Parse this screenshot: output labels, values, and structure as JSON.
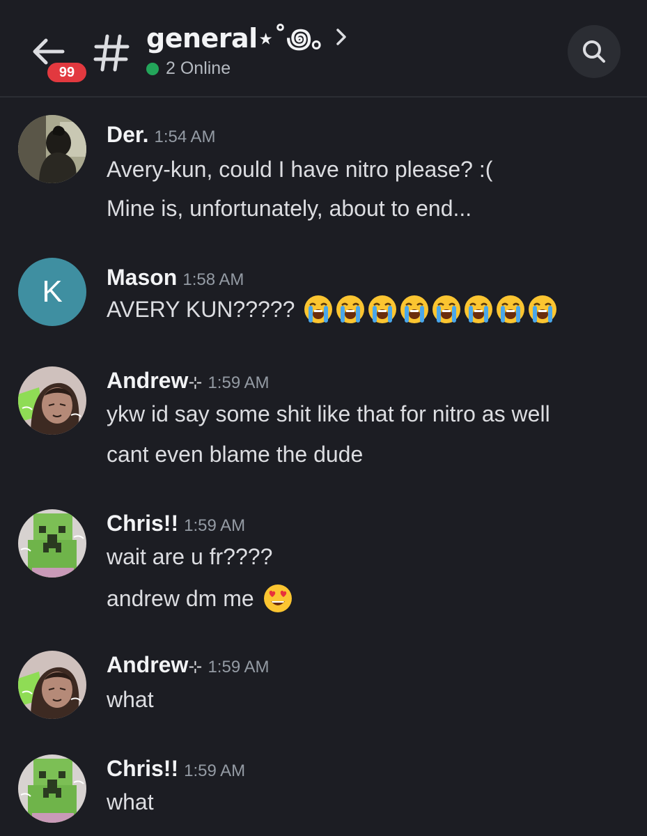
{
  "header": {
    "badge_count": "99",
    "channel_name": "general⋆˚꩜｡",
    "online_text": "2 Online"
  },
  "messages": [
    {
      "author": "Der.",
      "time": "1:54 AM",
      "lines": [
        "Avery-kun, could I have nitro please? :(",
        "Mine is, unfortunately, about to end..."
      ]
    },
    {
      "author": "Mason",
      "avatar_letter": "K",
      "time": "1:58 AM",
      "lines": [
        "AVERY KUN?????"
      ],
      "emoji": [
        "loudly-crying-face",
        "loudly-crying-face",
        "loudly-crying-face",
        "loudly-crying-face",
        "loudly-crying-face",
        "loudly-crying-face",
        "loudly-crying-face",
        "loudly-crying-face"
      ]
    },
    {
      "author": "Andrew",
      "author_suffix": "⊹",
      "time": "1:59 AM",
      "lines": [
        "ykw id say some shit like that for nitro as well",
        "cant even blame the dude"
      ]
    },
    {
      "author": "Chris!!",
      "time": "1:59 AM",
      "lines": [
        "wait are u fr????",
        "andrew dm me"
      ],
      "emoji": [
        "heart-eyes-face"
      ]
    },
    {
      "author": "Andrew",
      "author_suffix": "⊹",
      "time": "1:59 AM",
      "lines": [
        "what"
      ]
    },
    {
      "author": "Chris!!",
      "time": "1:59 AM",
      "lines": [
        "what"
      ]
    }
  ],
  "colors": {
    "background": "#1c1d23",
    "badge": "#e2393f",
    "online": "#23a55a",
    "mason_avatar": "#3f8fa1"
  }
}
